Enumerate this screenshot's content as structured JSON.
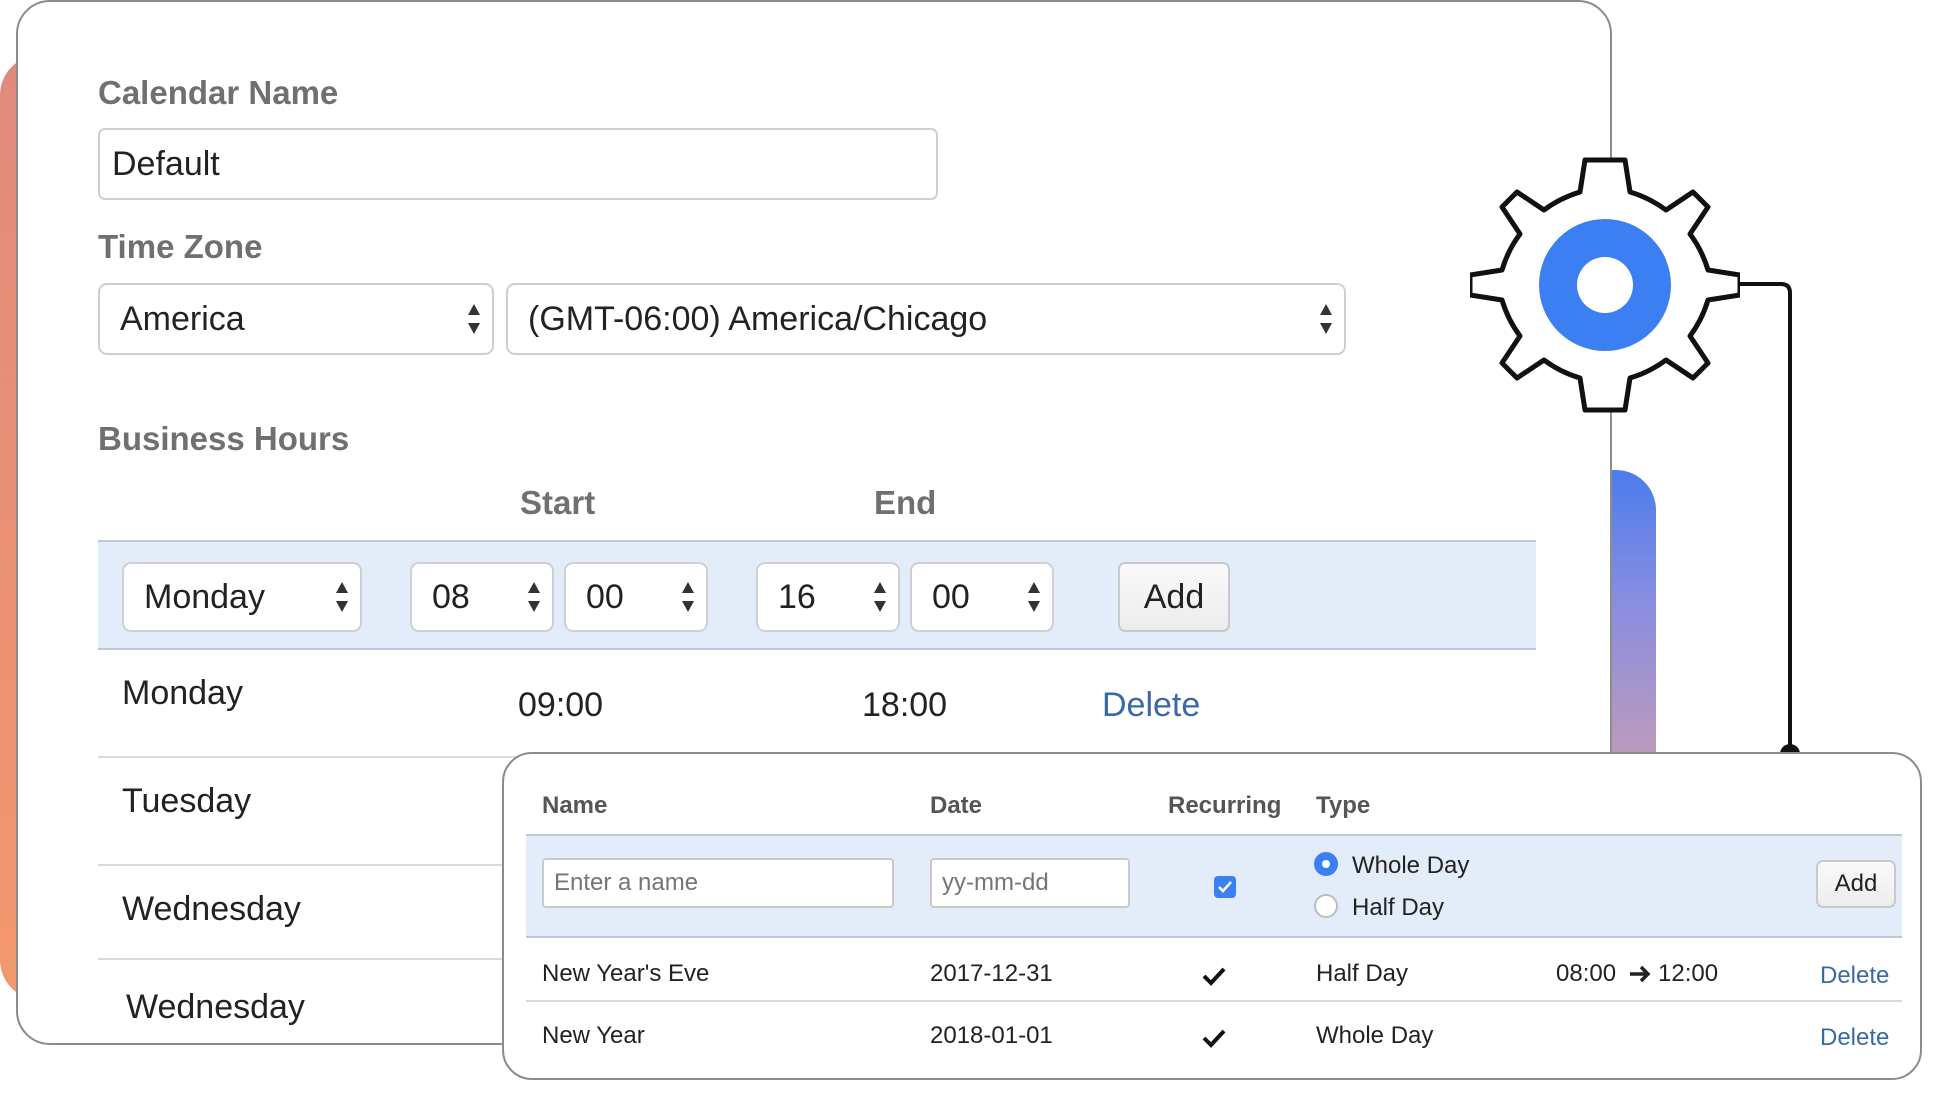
{
  "calendar": {
    "name_label": "Calendar Name",
    "name_value": "Default",
    "timezone_label": "Time Zone",
    "region_value": "America",
    "zone_value": "(GMT-06:00) America/Chicago"
  },
  "business_hours": {
    "label": "Business Hours",
    "start_header": "Start",
    "end_header": "End",
    "new_row": {
      "day": "Monday",
      "start_hour": "08",
      "start_minute": "00",
      "end_hour": "16",
      "end_minute": "00",
      "add_label": "Add"
    },
    "rows": [
      {
        "day": "Monday",
        "start": "09:00",
        "end": "18:00",
        "action": "Delete"
      },
      {
        "day": "Tuesday"
      },
      {
        "day": "Wednesday"
      },
      {
        "day": "Wednesday"
      }
    ]
  },
  "holidays": {
    "headers": {
      "name": "Name",
      "date": "Date",
      "recurring": "Recurring",
      "type": "Type"
    },
    "new_row": {
      "name_placeholder": "Enter a name",
      "date_placeholder": "yy-mm-dd",
      "recurring_checked": true,
      "type_options": [
        "Whole Day",
        "Half Day"
      ],
      "selected_type": "Whole Day",
      "add_label": "Add"
    },
    "rows": [
      {
        "name": "New Year's Eve",
        "date": "2017-12-31",
        "recurring": true,
        "type": "Half Day",
        "time_start": "08:00",
        "time_end": "12:00",
        "action": "Delete"
      },
      {
        "name": "New Year",
        "date": "2018-01-01",
        "recurring": true,
        "type": "Whole Day",
        "action": "Delete"
      }
    ]
  },
  "icons": {
    "gear": "gear-icon",
    "select_arrows": "select-arrows-icon",
    "checkmark": "checkmark-icon",
    "arrow": "arrow-right-icon"
  },
  "colors": {
    "accent_blue": "#3b7ff2",
    "band_blue": "#e3ecf9",
    "link_blue": "#3a68a8",
    "accent_orange": "#f3986e"
  }
}
